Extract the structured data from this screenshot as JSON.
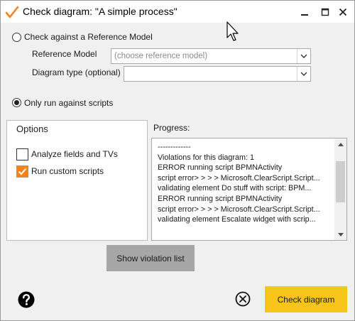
{
  "window": {
    "title": "Check diagram: \"A simple process\"",
    "accent_color": "#f58220"
  },
  "reference": {
    "radio_label": "Check against a Reference Model",
    "model_label": "Reference Model",
    "model_placeholder": "(choose reference model)",
    "type_label": "Diagram type (optional)",
    "type_value": "",
    "selected": false
  },
  "scripts": {
    "radio_label": "Only run against scripts",
    "selected": true
  },
  "options": {
    "title": "Options",
    "items": [
      {
        "label": "Analyze fields and TVs",
        "checked": false
      },
      {
        "label": "Run custom scripts",
        "checked": true
      }
    ]
  },
  "progress": {
    "label": "Progress:",
    "lines": [
      "-------------",
      "Violations for this diagram: 1",
      "    ERROR running script BPMNActivity",
      "script error> > > > Microsoft.ClearScript.Script...",
      "  validating element Do stuff with script: BPM...",
      "    ERROR running script BPMNActivity",
      "script error> > > > Microsoft.ClearScript.Script...",
      "  validating element Escalate widget with scrip..."
    ],
    "scroll_fraction": 0.3
  },
  "buttons": {
    "show_violations": "Show violation list",
    "check_diagram": "Check diagram"
  },
  "icons": {
    "app": "orange-checkmark-icon",
    "minimize": "minimize-icon",
    "maximize": "maximize-icon",
    "close": "close-icon",
    "help": "help-icon",
    "cancel": "cancel-circle-icon"
  }
}
